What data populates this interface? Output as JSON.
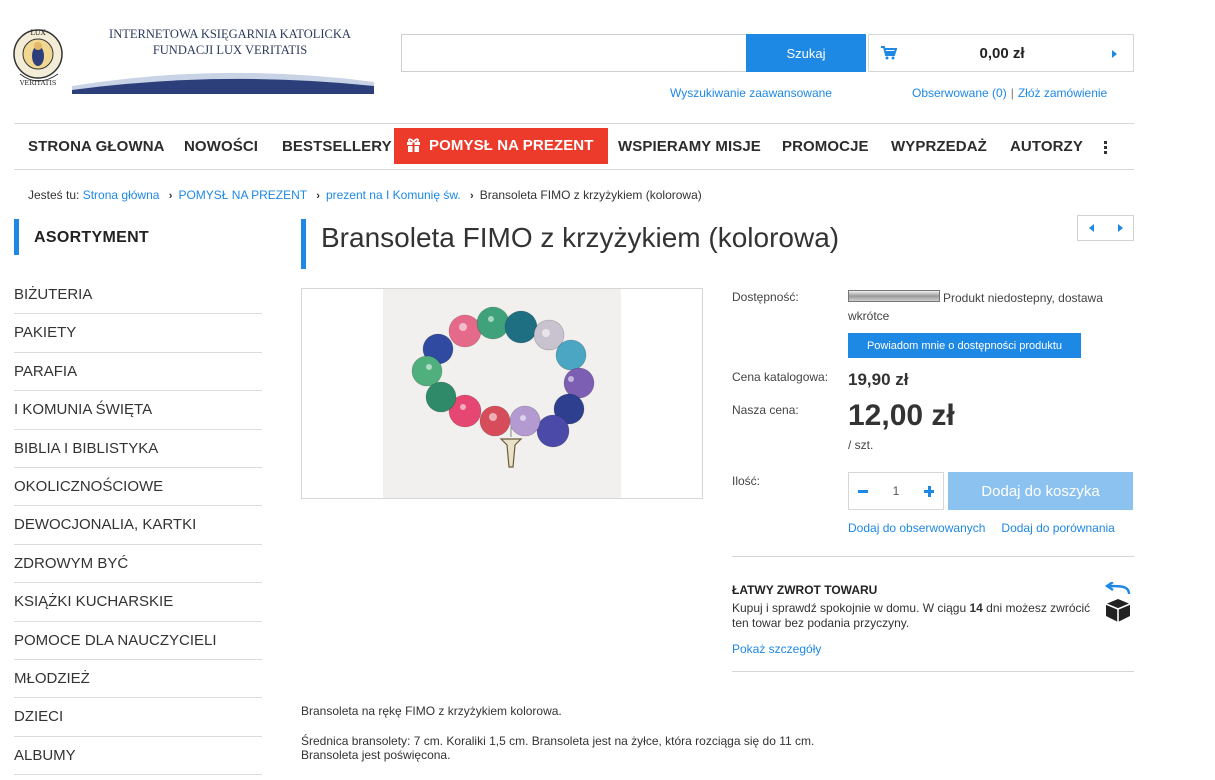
{
  "logo": {
    "line1": "INTERNETOWA KSIĘGARNIA KATOLICKA",
    "line2": "FUNDACJI LUX VERITATIS",
    "seal_text_top": "LUX",
    "seal_text_bottom": "VERITATIS"
  },
  "search": {
    "value": "",
    "placeholder": "",
    "button": "Szukaj",
    "advanced": "Wyszukiwanie zaawansowane"
  },
  "cart": {
    "total": "0,00 zł",
    "icon": "cart-icon"
  },
  "user_links": {
    "watched": "Obserwowane (0)",
    "separator": "|",
    "order": "Złóż zamówienie"
  },
  "nav": {
    "items": [
      "STRONA GŁOWNA",
      "NOWOŚCI",
      "BESTSELLERY",
      "POMYSŁ NA PREZENT",
      "WSPIERAMY MISJE",
      "PROMOCJE",
      "WYPRZEDAŻ",
      "AUTORZY"
    ],
    "highlight_color": "#ec3b2a"
  },
  "breadcrumb": {
    "prefix": "Jesteś tu:",
    "items": [
      "Strona główna",
      "POMYSŁ NA PREZENT",
      "prezent na I Komunię św.",
      "Bransoleta FIMO z krzyżykiem (kolorowa)"
    ]
  },
  "sidebar": {
    "title": "ASORTYMENT",
    "items": [
      "BIŻUTERIA",
      "PAKIETY",
      "PARAFIA",
      "I KOMUNIA ŚWIĘTA",
      "BIBLIA I BIBLISTYKA",
      "OKOLICZNOŚCIOWE",
      "DEWOCJONALIA, KARTKI",
      "ZDROWYM BYĆ",
      "KSIĄŻKI KUCHARSKIE",
      "POMOCE DLA NAUCZYCIELI",
      "MŁODZIEŻ",
      "DZIECI",
      "ALBUMY"
    ]
  },
  "product": {
    "title": "Bransoleta FIMO z krzyżykiem (kolorowa)",
    "availability_label": "Dostępność:",
    "availability_text": "Produkt niedostepny, dostawa wkrótce",
    "notify_button": "Powiadom mnie o dostępności produktu",
    "list_price_label": "Cena katalogowa:",
    "list_price": "19,90 zł",
    "our_price_label": "Nasza cena:",
    "our_price": "12,00 zł",
    "unit": "/ szt.",
    "qty_label": "Ilość:",
    "qty_value": "1",
    "add_to_cart": "Dodaj do koszyka",
    "add_watch": "Dodaj do obserwowanych",
    "add_compare": "Dodaj do porównania"
  },
  "returns": {
    "title": "ŁATWY ZWROT TOWARU",
    "text_before": "Kupuj i sprawdź spokojnie w domu. W ciągu ",
    "days": "14",
    "text_after": " dni możesz zwrócić ten towar bez podania przyczyny.",
    "link": "Pokaż szczegóły"
  },
  "description": {
    "line1": "Bransoleta na rękę FIMO z krzyżykiem kolorowa.",
    "line2": "Średnica bransolety: 7 cm. Koraliki 1,5 cm. Bransoleta jest na żyłce, która rozciąga się do 11 cm.",
    "line3": "Bransoleta jest poświęcona."
  },
  "colors": {
    "accent": "#1e88e5",
    "gift": "#ec3b2a",
    "add_to_cart_disabled": "#8cc2ef"
  }
}
